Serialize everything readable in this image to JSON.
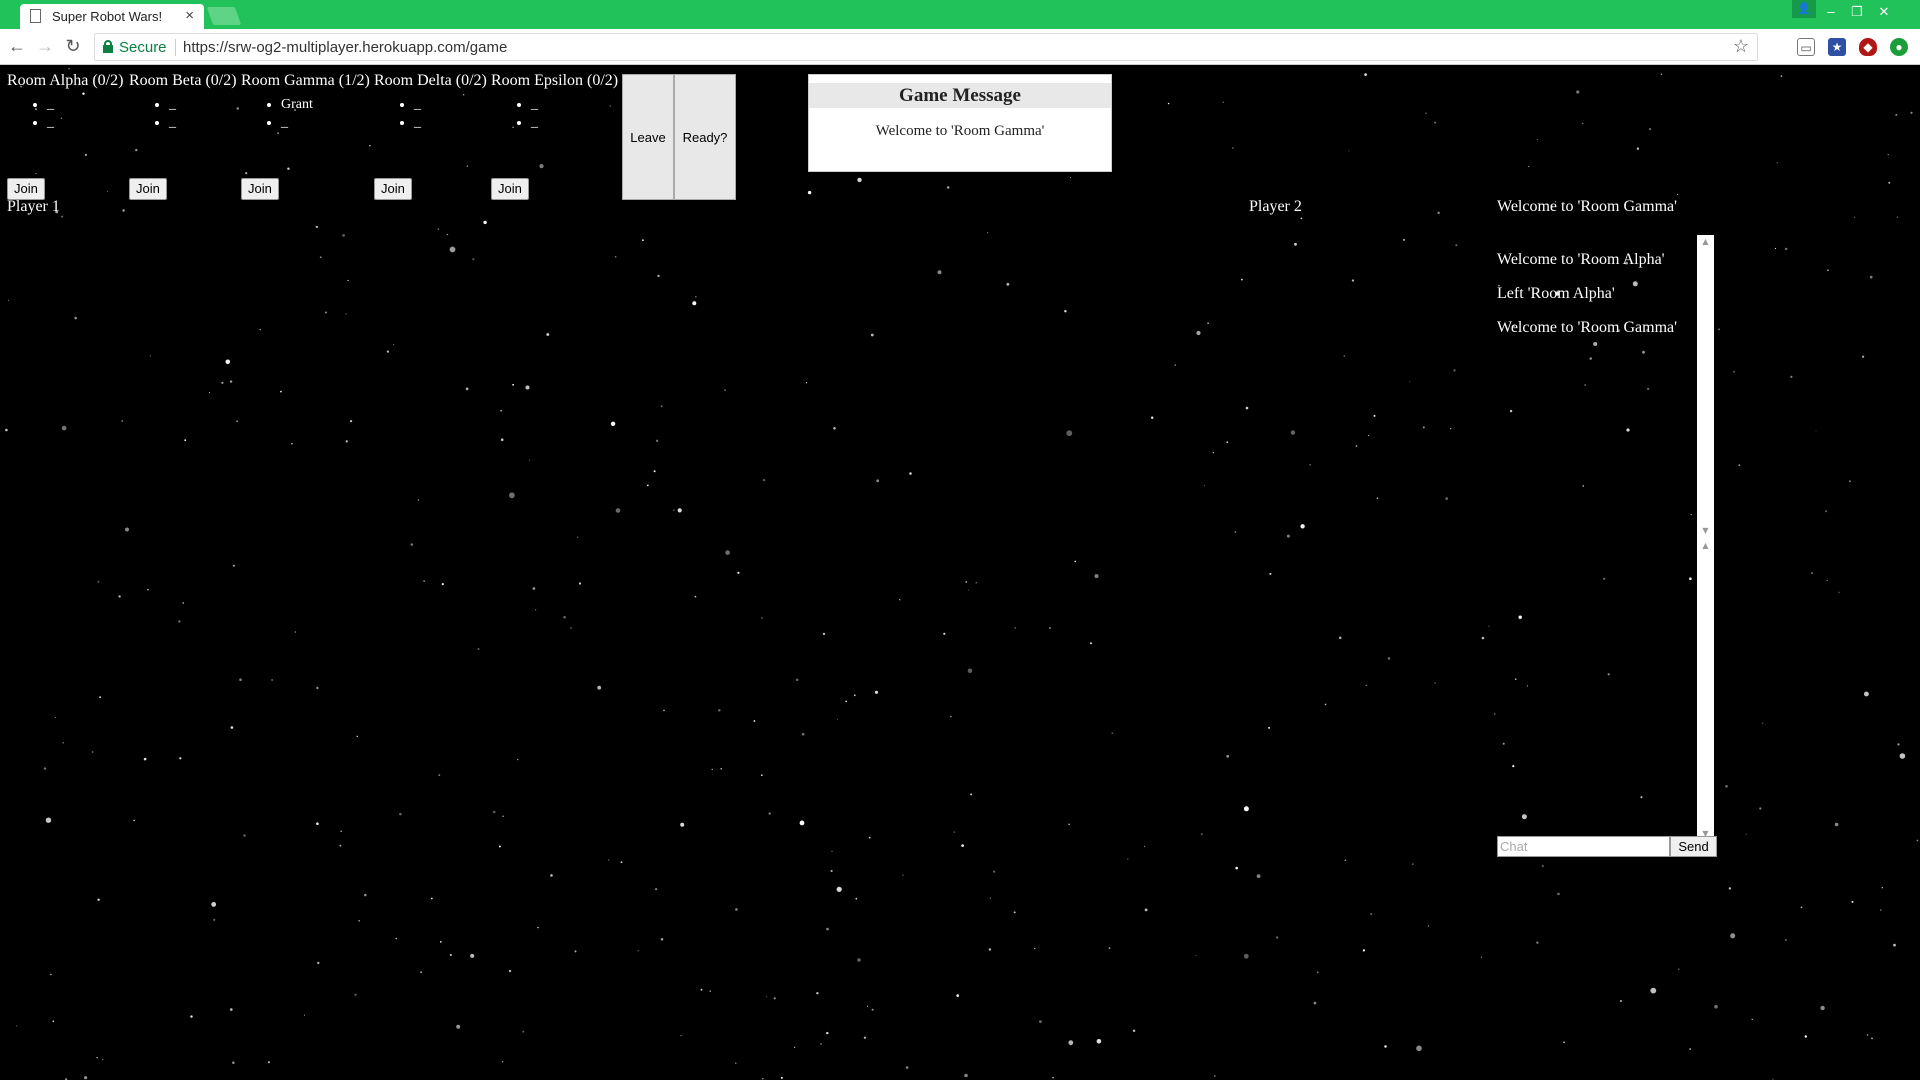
{
  "browser": {
    "tab_title": "Super Robot Wars!",
    "tab_close": "×",
    "secure_label": "Secure",
    "url": "https://srw-og2-multiplayer.herokuapp.com/game"
  },
  "rooms": [
    {
      "title": "Room Alpha (0/2)",
      "players": [
        "_",
        "_"
      ],
      "join_label": "Join"
    },
    {
      "title": "Room Beta (0/2)",
      "players": [
        "_",
        "_"
      ],
      "join_label": "Join"
    },
    {
      "title": "Room Gamma (1/2)",
      "players": [
        "Grant",
        "_"
      ],
      "join_label": "Join"
    },
    {
      "title": "Room Delta (0/2)",
      "players": [
        "_",
        "_"
      ],
      "join_label": "Join"
    },
    {
      "title": "Room Epsilon (0/2)",
      "players": [
        "_",
        "_"
      ],
      "join_label": "Join"
    }
  ],
  "controls": {
    "leave_label": "Leave",
    "ready_label": "Ready?"
  },
  "game_message": {
    "title": "Game Message",
    "body": "Welcome to 'Room Gamma'"
  },
  "players": {
    "p1": "Player 1",
    "p2": "Player 2"
  },
  "room_status": "Welcome to 'Room Gamma'",
  "chat": {
    "log": [
      "Welcome to 'Room Alpha'",
      "Left 'Room Alpha'",
      "Welcome to 'Room Gamma'"
    ],
    "placeholder": "Chat",
    "send_label": "Send"
  },
  "colors": {
    "chrome_green": "#22c25a",
    "secure_green": "#0b8043",
    "background": "#000000"
  }
}
